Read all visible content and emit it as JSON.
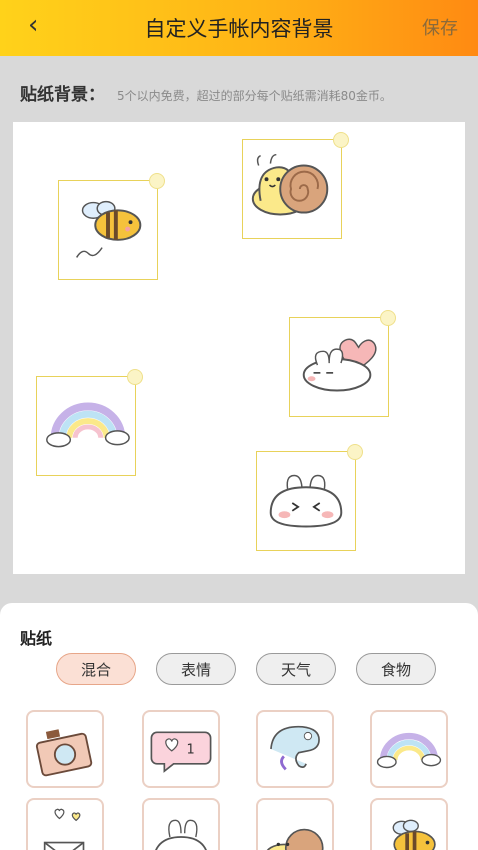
{
  "header": {
    "back_icon": "chevron-left-icon",
    "title": "自定义手帐内容背景",
    "save_label": "保存"
  },
  "info": {
    "label": "贴纸背景：",
    "note": "5个以内免费，超过的部分每个贴纸需消耗80金币。"
  },
  "canvas": {
    "stickers": [
      {
        "name": "bee"
      },
      {
        "name": "snail"
      },
      {
        "name": "bunny-heart"
      },
      {
        "name": "rainbow"
      },
      {
        "name": "bunny-face"
      }
    ]
  },
  "sheet": {
    "title": "贴纸",
    "categories": [
      "混合",
      "表情",
      "天气",
      "食物"
    ],
    "active_category": "混合",
    "tiles": [
      {
        "name": "camera"
      },
      {
        "name": "heart-bubble",
        "text": "1"
      },
      {
        "name": "chameleon"
      },
      {
        "name": "rainbow"
      },
      {
        "name": "love-letter"
      },
      {
        "name": "bunny-face"
      },
      {
        "name": "snail"
      },
      {
        "name": "bee"
      }
    ]
  },
  "colors": {
    "header_start": "#ffd21a",
    "header_end": "#ff8a12",
    "chip_active": "#fbe0d5",
    "slot_border": "#e8d25a"
  }
}
